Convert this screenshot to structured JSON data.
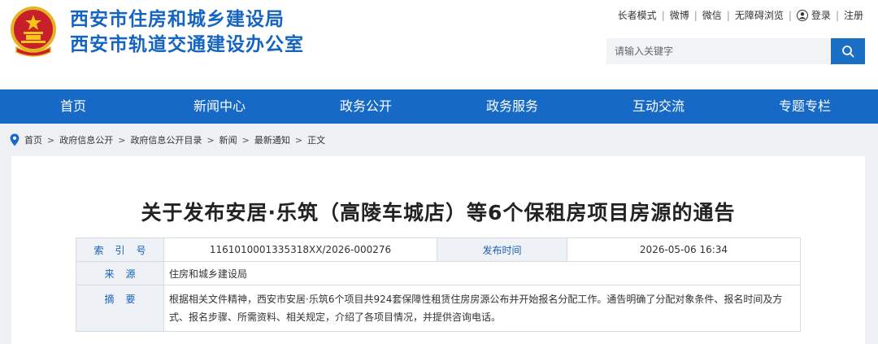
{
  "header": {
    "title_line1": "西安市住房和城乡建设局",
    "title_line2": "西安市轨道交通建设办公室",
    "emblem_icon": "national-emblem-icon",
    "brand_color": "#1565c0"
  },
  "toplinks": {
    "elder_mode": "长者模式",
    "weibo": "微博",
    "wechat": "微信",
    "accessible": "无障碍浏览",
    "login": "登录",
    "register": "注册"
  },
  "search": {
    "placeholder": "请输入关键字",
    "icon": "search-icon"
  },
  "nav": {
    "items": [
      "首页",
      "新闻中心",
      "政务公开",
      "政务服务",
      "互动交流",
      "专题专栏"
    ],
    "color": "#1769c6"
  },
  "breadcrumb": {
    "items": [
      "首页",
      "政府信息公开",
      "政府信息公开目录",
      "新闻",
      "最新通知",
      "正文"
    ],
    "separator": ">"
  },
  "article": {
    "title": "关于发布安居·乐筑（高陵车城店）等6个保租房项目房源的通告",
    "meta": {
      "index_label": "索引号",
      "index_value": "1161010001335318XX/2026-000276",
      "date_label": "发布时间",
      "date_value": "2026-05-06 16:34",
      "source_label": "来源",
      "source_value": "住房和城乡建设局",
      "summary_label": "摘要",
      "summary_value": "根据相关文件精神，西安市安居·乐筑6个项目共924套保障性租赁住房房源公布并开始报名分配工作。通告明确了分配对象条件、报名时间及方式、报名步骤、所需资料、相关规定，介绍了各项目情况，并提供咨询电话。"
    }
  }
}
